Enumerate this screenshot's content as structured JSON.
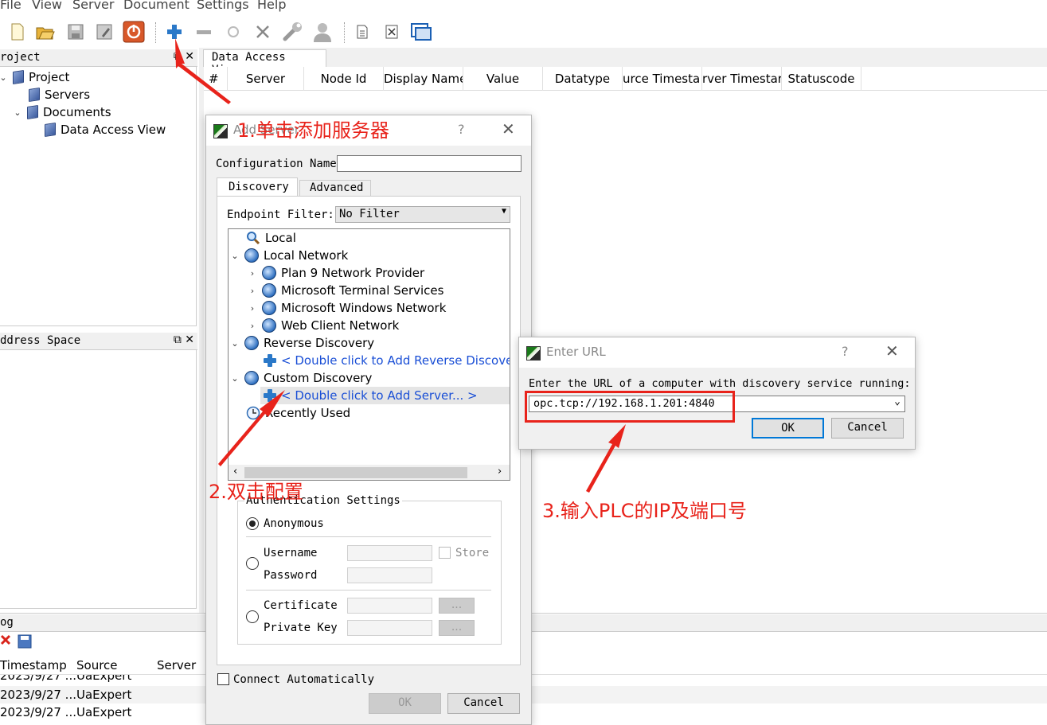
{
  "menu": [
    "File",
    "View",
    "Server",
    "Document",
    "Settings",
    "Help"
  ],
  "toolbar_icons": [
    "new-document-icon",
    "open-folder-icon",
    "save-icon",
    "save-as-icon",
    "power-icon",
    "add-server-icon",
    "remove-server-icon",
    "reconnect-icon",
    "disconnect-icon",
    "settings-wrench-icon",
    "user-icon",
    "new-document-small-icon",
    "delete-document-icon",
    "window-icon"
  ],
  "project_panel": {
    "title": "roject",
    "tree": [
      {
        "label": "Project",
        "level": 0
      },
      {
        "label": "Servers",
        "level": 1
      },
      {
        "label": "Documents",
        "level": 1
      },
      {
        "label": "Data Access View",
        "level": 2
      }
    ]
  },
  "address_panel": {
    "title": "ddress Space"
  },
  "log_panel": {
    "title": "og",
    "columns": [
      "Timestamp",
      "Source",
      "Server"
    ],
    "rows": [
      {
        "ts": "2023/9/27 ...",
        "source": "UaExpert"
      },
      {
        "ts": "2023/9/27 ...",
        "source": "UaExpert"
      },
      {
        "ts": "2023/9/27 ...",
        "source": "UaExpert"
      }
    ]
  },
  "main_tab": "Data Access View",
  "grid_columns": [
    "#",
    "Server",
    "Node Id",
    "Display Name",
    "Value",
    "Datatype",
    "urce Timesta",
    "rver Timestar",
    "Statuscode"
  ],
  "add_server_dialog": {
    "title": "Add Server",
    "config_name_label": "Configuration Name",
    "config_name_value": "",
    "tabs": [
      "Discovery",
      "Advanced"
    ],
    "endpoint_filter_label": "Endpoint Filter:",
    "endpoint_filter_value": "No Filter",
    "tree": [
      {
        "label": "Local",
        "icon": "magnifier-icon"
      },
      {
        "label": "Local Network",
        "icon": "network-globe-icon"
      },
      {
        "label": "Plan 9 Network Provider",
        "icon": "network-globe-icon"
      },
      {
        "label": "Microsoft Terminal Services",
        "icon": "network-globe-icon"
      },
      {
        "label": "Microsoft Windows Network",
        "icon": "network-globe-icon"
      },
      {
        "label": "Web Client Network",
        "icon": "network-globe-icon"
      },
      {
        "label": "Reverse Discovery",
        "icon": "network-globe-icon"
      },
      {
        "label": "< Double click to Add Reverse Discover",
        "icon": "plus-icon"
      },
      {
        "label": "Custom Discovery",
        "icon": "network-globe-icon"
      },
      {
        "label": "< Double click to Add Server... >",
        "icon": "plus-icon"
      },
      {
        "label": "Recently Used",
        "icon": "clock-icon"
      }
    ],
    "auth": {
      "title": "Authentication Settings",
      "anonymous": "Anonymous",
      "username": "Username",
      "password": "Password",
      "store": "Store",
      "certificate": "Certificate",
      "private_key": "Private Key",
      "browse": "..."
    },
    "connect_auto": "Connect Automatically",
    "ok": "OK",
    "cancel": "Cancel",
    "help": "?",
    "close": "✕"
  },
  "enter_url_dialog": {
    "title": "Enter URL",
    "prompt": "Enter the URL of a computer with discovery service running:",
    "url_value": "opc.tcp://192.168.1.201:4840",
    "ok": "OK",
    "cancel": "Cancel",
    "help": "?",
    "close": "✕"
  },
  "annotations": {
    "step1": "1.单击添加服务器",
    "step2": "2.双击配置",
    "step3": "3.输入PLC的IP及端口号"
  },
  "colors": {
    "annotation": "#e8231b",
    "link": "#1a4fd6",
    "selection": "#e5e5e5"
  }
}
